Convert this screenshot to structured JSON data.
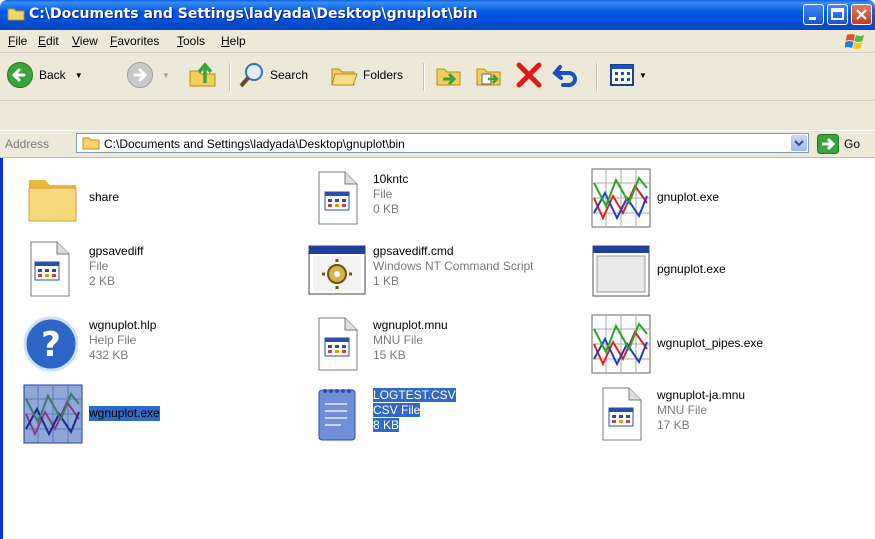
{
  "window": {
    "title": "C:\\Documents and Settings\\ladyada\\Desktop\\gnuplot\\bin"
  },
  "menu": [
    "File",
    "Edit",
    "View",
    "Favorites",
    "Tools",
    "Help"
  ],
  "toolbar": {
    "back": "Back",
    "search": "Search",
    "folders": "Folders"
  },
  "address": {
    "label": "Address",
    "value": "C:\\Documents and Settings\\ladyada\\Desktop\\gnuplot\\bin",
    "go": "Go"
  },
  "files": [
    {
      "name": "share",
      "type": "",
      "size": "",
      "icon": "folder-icon"
    },
    {
      "name": "10kntc",
      "type": "File",
      "size": "0 KB",
      "icon": "document-icon"
    },
    {
      "name": "gnuplot.exe",
      "type": "",
      "size": "",
      "icon": "plot-icon"
    },
    {
      "name": "gpsavediff",
      "type": "File",
      "size": "2 KB",
      "icon": "document-icon"
    },
    {
      "name": "gpsavediff.cmd",
      "type": "Windows NT Command Script",
      "size": "1 KB",
      "icon": "command-script-icon"
    },
    {
      "name": "pgnuplot.exe",
      "type": "",
      "size": "",
      "icon": "application-window-icon"
    },
    {
      "name": "wgnuplot.hlp",
      "type": "Help File",
      "size": "432 KB",
      "icon": "help-icon"
    },
    {
      "name": "wgnuplot.mnu",
      "type": "MNU File",
      "size": "15 KB",
      "icon": "document-icon"
    },
    {
      "name": "wgnuplot_pipes.exe",
      "type": "",
      "size": "",
      "icon": "plot-icon"
    },
    {
      "name": "wgnuplot.exe",
      "type": "",
      "size": "",
      "icon": "plot-icon",
      "selected": true
    },
    {
      "name": "LOGTEST.CSV",
      "type": "CSV File",
      "size": "8 KB",
      "icon": "notepad-icon",
      "selected": true
    },
    {
      "name": "wgnuplot-ja.mnu",
      "type": "MNU File",
      "size": "17 KB",
      "icon": "document-icon"
    }
  ]
}
